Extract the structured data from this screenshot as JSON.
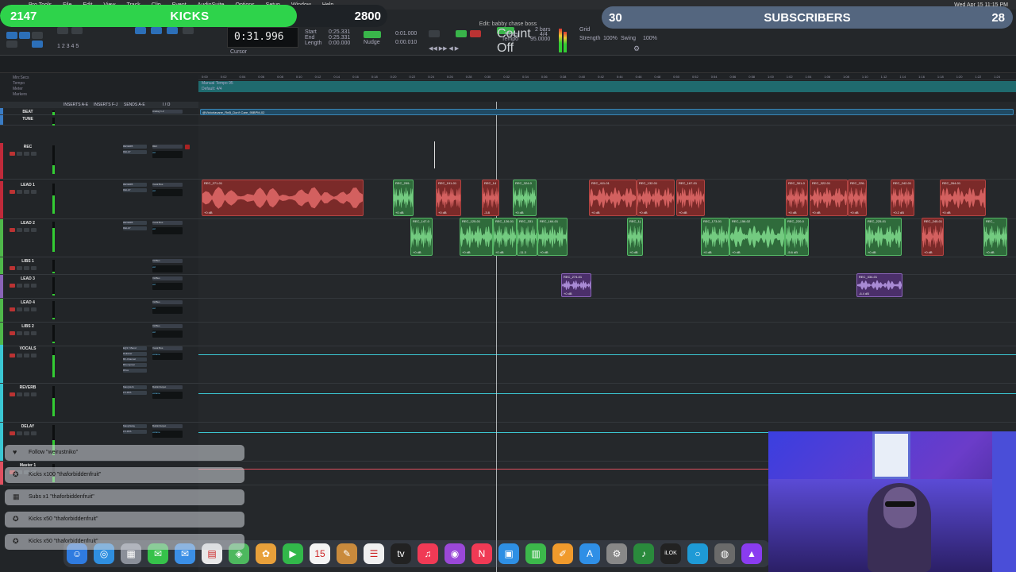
{
  "menubar": {
    "apple": "",
    "items": [
      "Pro Tools",
      "File",
      "Edit",
      "View",
      "Track",
      "Clip",
      "Event",
      "AudioSuite",
      "Options",
      "Setup",
      "Window",
      "Help"
    ],
    "datetime": "Wed Apr 15  11:15 PM"
  },
  "window_title": "Edit: babby chase boss",
  "counter": {
    "main": "0:31.996",
    "start_label": "Start",
    "end_label": "End",
    "length_label": "Length",
    "start": "0:25.331",
    "end": "0:25.331",
    "length": "0:00.000",
    "cursor_label": "Cursor",
    "nudge_label": "Nudge",
    "grid_label": "Grid",
    "nudge": "0:00.010",
    "grid": "0:01.000",
    "count_off": "Count Off",
    "meter_label": "Meter",
    "tempo_label": "Tempo",
    "bars": "2 bars",
    "meter": "4/4",
    "tempo": "95.0000",
    "strength_label": "Strength",
    "swing_label": "Swing",
    "strength": "100%",
    "swing": "100%"
  },
  "alerts": {
    "kicks": {
      "count": "2147",
      "label": "KICKS",
      "goal": "2800",
      "progress": 0.767,
      "color": "#2ed34b"
    },
    "subs": {
      "count": "30",
      "label": "SUBSCRIBERS",
      "goal": "28",
      "progress": 1.0,
      "color": "#54667f"
    }
  },
  "rulers": {
    "labels": [
      "Min:Secs",
      "Tempo",
      "Meter",
      "Markers"
    ],
    "tempo_text": "Manual Tempo   95",
    "meter_text": "Default: 4/4",
    "ticks": [
      "0:00",
      "0:02",
      "0:04",
      "0:06",
      "0:08",
      "0:10",
      "0:12",
      "0:14",
      "0:16",
      "0:18",
      "0:20",
      "0:22",
      "0:24",
      "0:26",
      "0:28",
      "0:30",
      "0:32",
      "0:34",
      "0:36",
      "0:38",
      "0:40",
      "0:42",
      "0:44",
      "0:46",
      "0:48",
      "0:50",
      "0:52",
      "0:54",
      "0:56",
      "0:58",
      "1:00",
      "1:02",
      "1:04",
      "1:06",
      "1:08",
      "1:10",
      "1:12",
      "1:14",
      "1:16",
      "1:18",
      "1:20",
      "1:22",
      "1:24"
    ]
  },
  "column_headers": [
    "INSERTS A-E",
    "INSERTS F-J",
    "SENDS A-E",
    "I / O"
  ],
  "tracks": [
    {
      "name": "BEAT",
      "color": "#3a7cc4",
      "inserts": [],
      "io": "Analog 1-2",
      "vol": "vol",
      "meter": 0.7
    },
    {
      "name": "TUNE",
      "color": "#3a7cc4",
      "inserts": [],
      "io": "",
      "vol": "",
      "meter": 0.2
    },
    {
      "name": "REC",
      "color": "#c02a3a",
      "inserts": [
        "REVERB",
        "DELAY"
      ],
      "io": "REC",
      "vol": "vol",
      "meter": 0.3
    },
    {
      "name": "LEAD 1",
      "color": "#c02a3a",
      "inserts": [
        "REVERB",
        "DELAY"
      ],
      "io": "Vocal Bus",
      "vol": "vol",
      "meter": 0.6
    },
    {
      "name": "LEAD 2",
      "color": "#4fb84a",
      "inserts": [
        "REVERB",
        "DELAY"
      ],
      "io": "Vocal Bus",
      "vol": "vol",
      "meter": 0.8
    },
    {
      "name": "LIBS 1",
      "color": "#4fb84a",
      "inserts": [],
      "io": "VirtBus",
      "vol": "vol",
      "meter": 0.1
    },
    {
      "name": "LEAD 3",
      "color": "#8a64b8",
      "inserts": [],
      "io": "VirtBus",
      "vol": "vol",
      "meter": 0.1
    },
    {
      "name": "LEAD 4",
      "color": "#4fb84a",
      "inserts": [],
      "io": "VirtBus",
      "vol": "vol",
      "meter": 0.1
    },
    {
      "name": "LIBS 2",
      "color": "#4fb84a",
      "inserts": [],
      "io": "VirtBus",
      "vol": "vol",
      "meter": 0.1
    },
    {
      "name": "VOCALS",
      "color": "#3bc7d3",
      "inserts": [
        "EQ3 7-Band",
        "DeEsser",
        "BF-Channel",
        "BComprssr",
        "RVox"
      ],
      "io": "Vocal Bus",
      "vol": "volume",
      "meter": 0.75
    },
    {
      "name": "REVERB",
      "color": "#3bc7d3",
      "inserts": [
        "ManyVerb",
        "FX-RTA"
      ],
      "io": "BuiltinOutput",
      "vol": "volume",
      "meter": 0.6
    },
    {
      "name": "DELAY",
      "color": "#3bc7d3",
      "inserts": [
        "ManyDelay",
        "FX-RTA"
      ],
      "io": "BuiltinOutput",
      "vol": "volume",
      "meter": 0.5
    },
    {
      "name": "Master 1",
      "color": "#e05060",
      "inserts": [],
      "io": "",
      "vol": "",
      "meter": 0.3
    }
  ],
  "beat_clip": {
    "name": "@Victorlavane_RnB_Don't Care_95BPM-02"
  },
  "clips": {
    "lead1": [
      {
        "name": "REC_271-01",
        "gain": "+0 dB"
      },
      {
        "name": "REC_299-",
        "gain": "+0 dB"
      },
      {
        "name": "REC_191-01",
        "gain": "+0 dB"
      },
      {
        "name": "REC_14",
        "gain": "-3.8"
      },
      {
        "name": "REC_324-0",
        "gain": "+0 dB"
      },
      {
        "name": "REC_411-01",
        "gain": "+0 dB"
      },
      {
        "name": "REC_132-01",
        "gain": "+0 dB"
      },
      {
        "name": "REC_167-01",
        "gain": "+0 dB"
      },
      {
        "name": "REC_301-0",
        "gain": "+0 dB"
      },
      {
        "name": "REC_322-01",
        "gain": "+0 dB"
      },
      {
        "name": "REC_226-",
        "gain": "+0 dB"
      },
      {
        "name": "REC_242-01",
        "gain": "+0.2 dB"
      },
      {
        "name": "REC_264-01",
        "gain": "+0 dB"
      }
    ],
    "lead2": [
      {
        "name": "REC_147-0",
        "gain": "+0 dB"
      },
      {
        "name": "REC_125-01",
        "gain": "+0 dB"
      },
      {
        "name": "REC_126-01",
        "gain": "+0 dB"
      },
      {
        "name": "REC_331",
        "gain": "-11.3"
      },
      {
        "name": "REC_164-01",
        "gain": "+0 dB"
      },
      {
        "name": "REC_1(",
        "gain": "+0 dB"
      },
      {
        "name": "REC_173-01",
        "gain": "+0 dB"
      },
      {
        "name": "REC_156-02",
        "gain": "+0 dB"
      },
      {
        "name": "REC_220-0",
        "gain": "-5.6 dB"
      },
      {
        "name": "REC_225-01",
        "gain": "+0 dB"
      },
      {
        "name": "REC_245-01",
        "gain": "+0 dB"
      },
      {
        "name": "REC_",
        "gain": "+0 dB"
      }
    ],
    "lead3": [
      {
        "name": "REC_274-01",
        "gain": "+0 dB"
      },
      {
        "name": "REC_334-01",
        "gain": "-6.4 dB"
      }
    ]
  },
  "events": [
    {
      "icon": "heart-icon",
      "glyph": "♥",
      "text": "Follow \"weirustniko\""
    },
    {
      "icon": "kick-icon",
      "glyph": "✪",
      "text": "Kicks x100 \"thaforbiddenfruit\""
    },
    {
      "icon": "sub-icon",
      "glyph": "▦",
      "text": "Subs x1 \"thaforbiddenfruit\""
    },
    {
      "icon": "kick-icon",
      "glyph": "✪",
      "text": "Kicks x50 \"thaforbiddenfruit\""
    },
    {
      "icon": "kick-icon",
      "glyph": "✪",
      "text": "Kicks x50 \"thaforbiddenfruit\""
    }
  ],
  "dock": [
    {
      "name": "finder-icon",
      "color": "#2f7be0",
      "glyph": "☺"
    },
    {
      "name": "safari-icon",
      "color": "#2f8fe0",
      "glyph": "◎"
    },
    {
      "name": "launchpad-icon",
      "color": "#8a8f99",
      "glyph": "▦"
    },
    {
      "name": "messages-icon",
      "color": "#36c24a",
      "glyph": "✉"
    },
    {
      "name": "mail-icon",
      "color": "#3b8fe6",
      "glyph": "✉"
    },
    {
      "name": "files-icon",
      "color": "#e8e8e8",
      "glyph": "▤"
    },
    {
      "name": "maps-icon",
      "color": "#4db85e",
      "glyph": "◈"
    },
    {
      "name": "photos-icon",
      "color": "#e8a03a",
      "glyph": "✿"
    },
    {
      "name": "facetime-icon",
      "color": "#32b84a",
      "glyph": "▶"
    },
    {
      "name": "calendar-icon",
      "color": "#f4f4f4",
      "glyph": "15"
    },
    {
      "name": "notes-icon",
      "color": "#c98a3c",
      "glyph": "✎"
    },
    {
      "name": "reminders-icon",
      "color": "#f0f0f0",
      "glyph": "☰"
    },
    {
      "name": "tv-icon",
      "color": "#222",
      "glyph": "tv"
    },
    {
      "name": "music-icon",
      "color": "#f03a55",
      "glyph": "♫"
    },
    {
      "name": "podcasts-icon",
      "color": "#9a48d8",
      "glyph": "◉"
    },
    {
      "name": "news-icon",
      "color": "#f03a55",
      "glyph": "N"
    },
    {
      "name": "keynote-icon",
      "color": "#2e8fe4",
      "glyph": "▣"
    },
    {
      "name": "numbers-icon",
      "color": "#3cb84b",
      "glyph": "▥"
    },
    {
      "name": "pages-icon",
      "color": "#f09a2c",
      "glyph": "✐"
    },
    {
      "name": "appstore-icon",
      "color": "#2f8fe6",
      "glyph": "A"
    },
    {
      "name": "settings-icon",
      "color": "#888",
      "glyph": "⚙"
    },
    {
      "name": "instruments-icon",
      "color": "#2a8a3c",
      "glyph": "♪"
    },
    {
      "name": "ilok-icon",
      "color": "#222",
      "glyph": "iLOK"
    },
    {
      "name": "circle-app-icon",
      "color": "#1e9ad6",
      "glyph": "○"
    },
    {
      "name": "protools-icon",
      "color": "#6a6a6a",
      "glyph": "◍"
    },
    {
      "name": "avid-icon",
      "color": "#8a3cf0",
      "glyph": "▲"
    }
  ]
}
